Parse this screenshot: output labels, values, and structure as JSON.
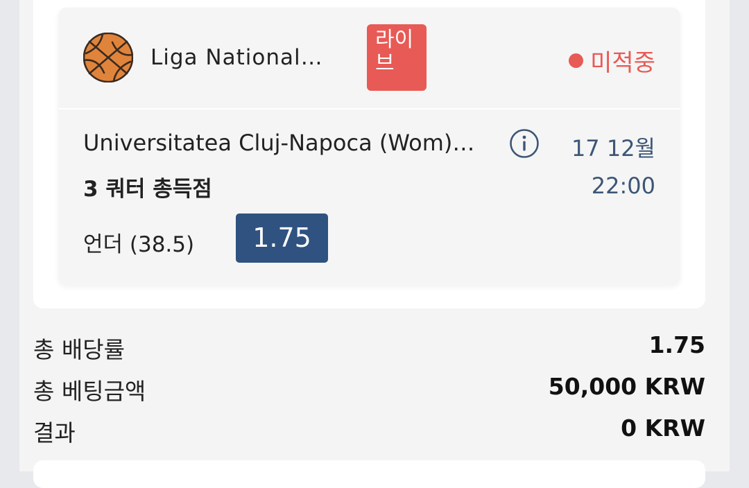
{
  "bet": {
    "league": "Liga National…",
    "live_badge": "라이브",
    "status": "미적중",
    "match": "Universitatea Cluj-Napoca (Wom)…",
    "date": "17 12월",
    "time": "22:00",
    "market": "3 쿼터 총득점",
    "selection": "언더 (38.5)",
    "odds": "1.75",
    "icons": {
      "sport": "basketball-icon",
      "info": "info-icon"
    }
  },
  "summary": {
    "total_odds_label": "총 배당률",
    "total_odds_value": "1.75",
    "total_stake_label": "총 베팅금액",
    "total_stake_value": "50,000 KRW",
    "result_label": "결과",
    "result_value": "0 KRW"
  },
  "colors": {
    "live": "#e85a55",
    "status_lost": "#e85a55",
    "odds_button": "#2f5280",
    "date_text": "#3c5676",
    "basketball": "#e0843b"
  }
}
